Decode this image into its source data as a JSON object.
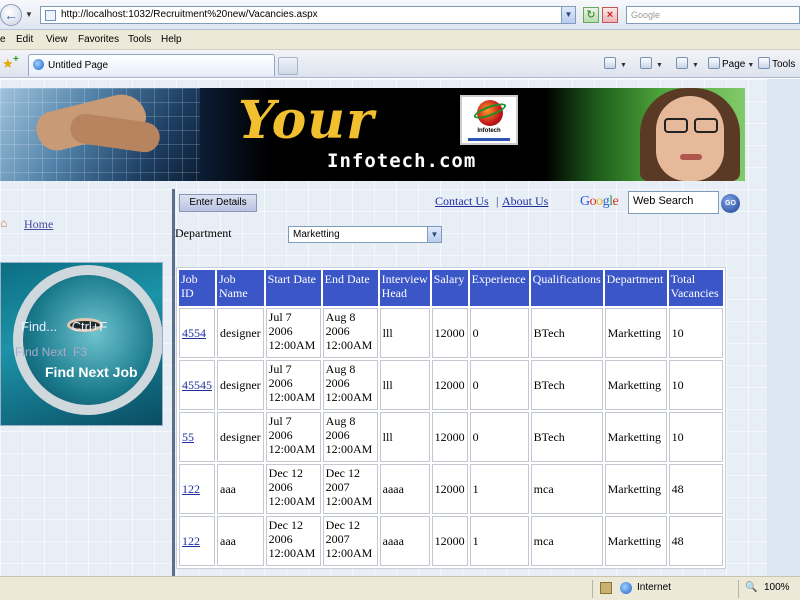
{
  "browser": {
    "url": "http://localhost:1032/Recruitment%20new/Vacancies.aspx",
    "search_placeholder": "Google",
    "menu": [
      "e",
      "Edit",
      "View",
      "Favorites",
      "Tools",
      "Help"
    ],
    "tab_title": "Untitled Page",
    "toolbar": {
      "page_label": "Page",
      "tools_label": "Tools"
    },
    "status": {
      "zone": "Internet",
      "zoom": "100%"
    }
  },
  "banner": {
    "title": "Your",
    "domain": "Infotech.com",
    "logo_text": "Infotech"
  },
  "sidebar": {
    "home_label": "Home",
    "image_text": {
      "find": "Find...",
      "shortcut": "Ctrl+F",
      "find_next": "Find Next",
      "next_key": "F3",
      "find_next_job": "Find Next Job"
    }
  },
  "header": {
    "enter_details_label": "Enter Details",
    "contact_label": "Contact Us",
    "separator": "|",
    "about_label": "About Us",
    "google_label": "Google",
    "search_value": "Web Search",
    "go_label": "GO"
  },
  "filter": {
    "department_label": "Department",
    "department_value": "Marketting"
  },
  "table": {
    "columns": [
      "Job ID",
      "Job Name",
      "Start Date",
      "End Date",
      "Interview Head",
      "Salary",
      "Experience",
      "Qualifications",
      "Department",
      "Total Vacancies"
    ],
    "rows": [
      {
        "id": "4554",
        "name": "designer",
        "start": "Jul 7 2006 12:00AM",
        "end": "Aug 8 2006 12:00AM",
        "head": "lll",
        "salary": "12000",
        "experience": "0",
        "qualifications": "BTech",
        "department": "Marketting",
        "total": "10"
      },
      {
        "id": "45545",
        "name": "designer",
        "start": "Jul 7 2006 12:00AM",
        "end": "Aug 8 2006 12:00AM",
        "head": "lll",
        "salary": "12000",
        "experience": "0",
        "qualifications": "BTech",
        "department": "Marketting",
        "total": "10"
      },
      {
        "id": "55",
        "name": "designer",
        "start": "Jul 7 2006 12:00AM",
        "end": "Aug 8 2006 12:00AM",
        "head": "lll",
        "salary": "12000",
        "experience": "0",
        "qualifications": "BTech",
        "department": "Marketting",
        "total": "10"
      },
      {
        "id": "122",
        "name": "aaa",
        "start": "Dec 12 2006 12:00AM",
        "end": "Dec 12 2007 12:00AM",
        "head": "aaaa",
        "salary": "12000",
        "experience": "1",
        "qualifications": "mca",
        "department": "Marketting",
        "total": "48"
      },
      {
        "id": "122",
        "name": "aaa",
        "start": "Dec 12 2006 12:00AM",
        "end": "Dec 12 2007 12:00AM",
        "head": "aaaa",
        "salary": "12000",
        "experience": "1",
        "qualifications": "mca",
        "department": "Marketting",
        "total": "48"
      }
    ]
  },
  "colors": {
    "banner_gold": "#f2c02e",
    "table_header": "#3b56c7",
    "link_blue": "#1e2f9e"
  }
}
